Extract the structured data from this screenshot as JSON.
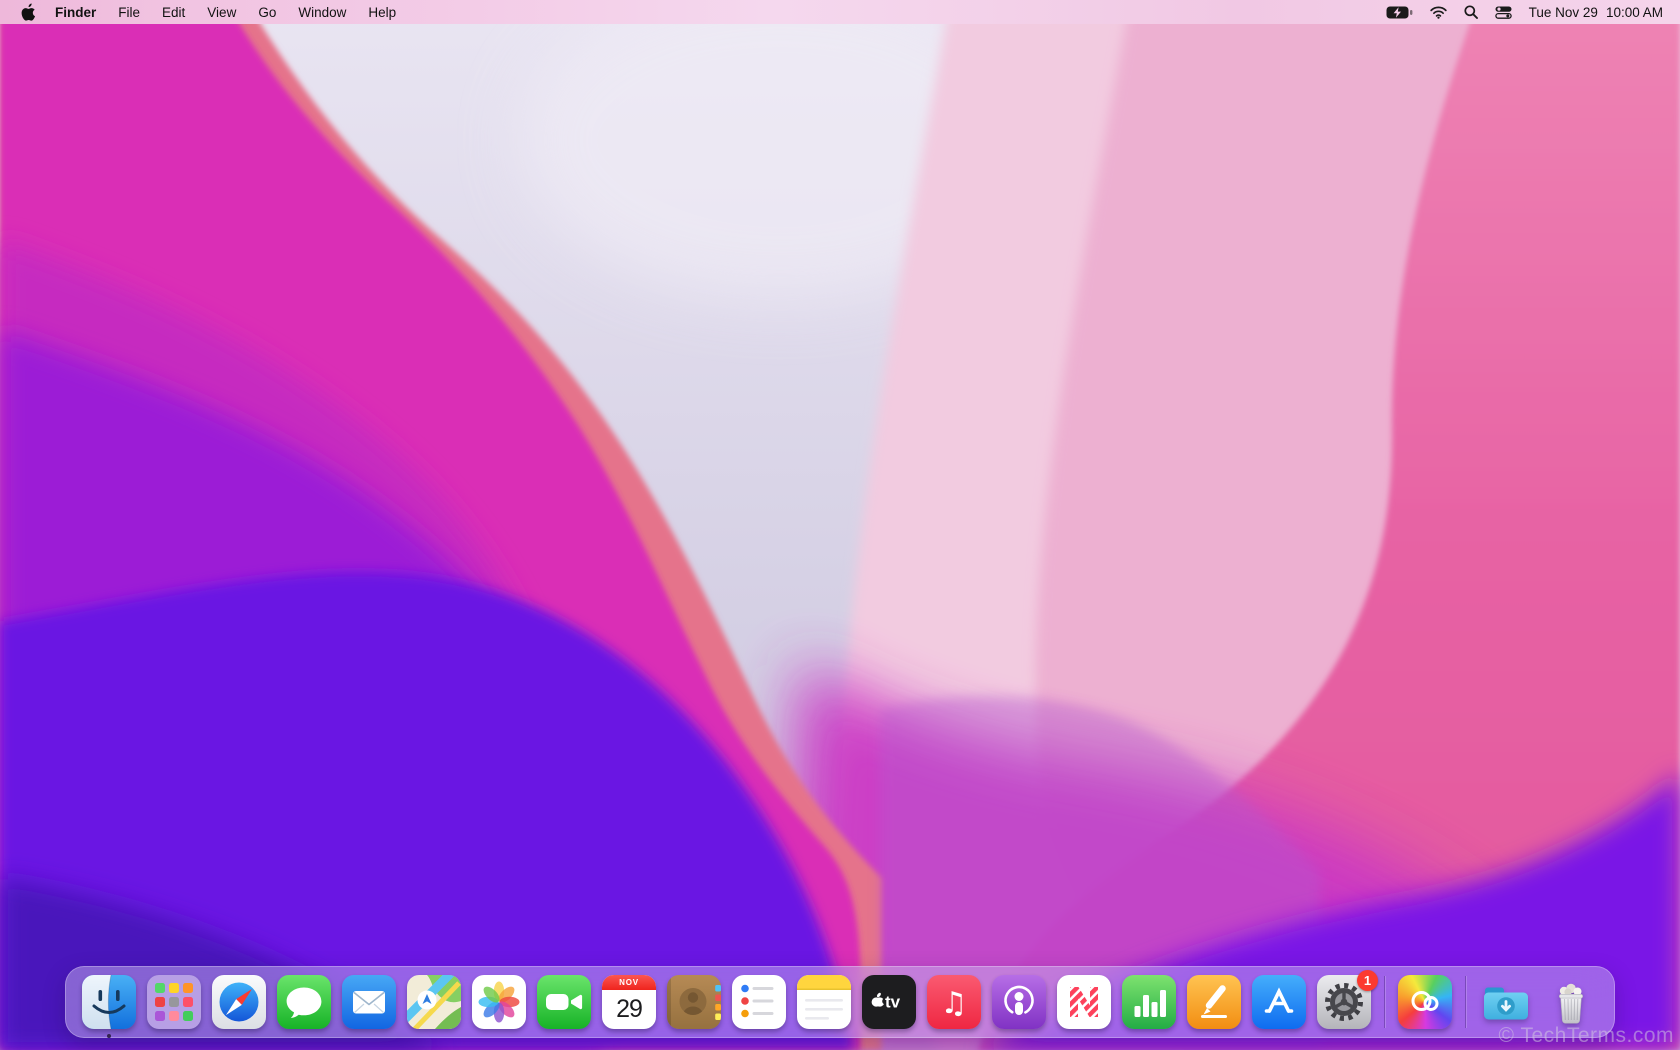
{
  "menubar": {
    "apple_menu": "apple-logo",
    "active_app": "Finder",
    "menus": [
      "Finder",
      "File",
      "Edit",
      "View",
      "Go",
      "Window",
      "Help"
    ],
    "status_icons": [
      "battery-charging-icon",
      "wifi-icon",
      "spotlight-search-icon",
      "control-center-icon"
    ],
    "clock_date": "Tue Nov 29",
    "clock_time": "10:00 AM"
  },
  "dock": {
    "items": [
      {
        "id": "finder",
        "label": "Finder",
        "running": true
      },
      {
        "id": "launchpad",
        "label": "Launchpad"
      },
      {
        "id": "safari",
        "label": "Safari"
      },
      {
        "id": "messages",
        "label": "Messages"
      },
      {
        "id": "mail",
        "label": "Mail"
      },
      {
        "id": "maps",
        "label": "Maps"
      },
      {
        "id": "photos",
        "label": "Photos"
      },
      {
        "id": "facetime",
        "label": "FaceTime"
      },
      {
        "id": "calendar",
        "label": "Calendar",
        "month": "NOV",
        "day": "29"
      },
      {
        "id": "contacts",
        "label": "Contacts"
      },
      {
        "id": "reminders",
        "label": "Reminders"
      },
      {
        "id": "notes",
        "label": "Notes"
      },
      {
        "id": "tv",
        "label": "TV",
        "text": "tv"
      },
      {
        "id": "music",
        "label": "Music"
      },
      {
        "id": "podcasts",
        "label": "Podcasts"
      },
      {
        "id": "news",
        "label": "News"
      },
      {
        "id": "numbers",
        "label": "Numbers"
      },
      {
        "id": "pages",
        "label": "Pages"
      },
      {
        "id": "appstore",
        "label": "App Store"
      },
      {
        "id": "sysprefs",
        "label": "System Preferences",
        "badge": "1"
      },
      {
        "type": "separator"
      },
      {
        "id": "creativecloud",
        "label": "Adobe Creative Cloud"
      },
      {
        "type": "separator"
      },
      {
        "id": "downloads",
        "label": "Downloads"
      },
      {
        "id": "trash",
        "label": "Trash"
      }
    ]
  },
  "watermark": "© TechTerms.com",
  "colors": {
    "menubar_tint": "#f3cde8",
    "dock_tint": "rgba(196,176,235,0.50)",
    "badge_red": "#fc3a30",
    "wallpaper_palette": [
      "#e9e5f2",
      "#f2cbe0",
      "#edb0d1",
      "#e763a4",
      "#e5738b",
      "#da2fb6",
      "#c62ac0",
      "#9c1ed6",
      "#6a15e3",
      "#4a13bb"
    ]
  }
}
